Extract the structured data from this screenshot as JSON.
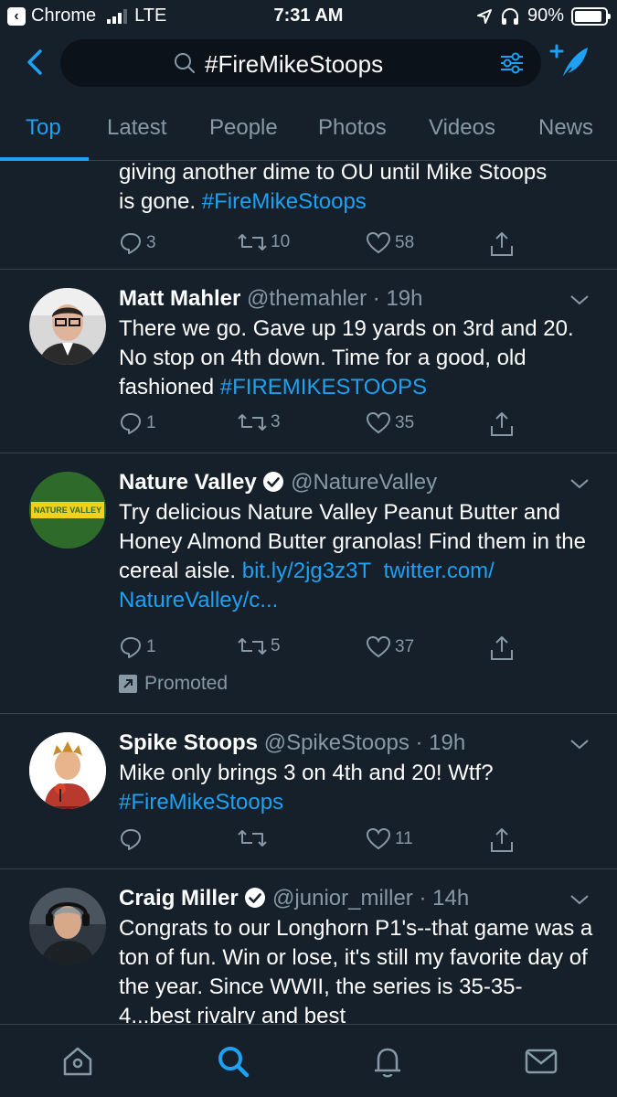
{
  "status_bar": {
    "back_app": "Chrome",
    "network": "LTE",
    "time": "7:31 AM",
    "battery": "90%"
  },
  "search": {
    "query": "#FireMikeStoops"
  },
  "tabs": [
    {
      "label": "Top",
      "active": true
    },
    {
      "label": "Latest",
      "active": false
    },
    {
      "label": "People",
      "active": false
    },
    {
      "label": "Photos",
      "active": false
    },
    {
      "label": "Videos",
      "active": false
    },
    {
      "label": "News",
      "active": false
    }
  ],
  "tweets": [
    {
      "text_line1": "giving another dime to OU until Mike Stoops",
      "text_line2": "is gone. ",
      "hashtag": "#FireMikeStoops",
      "replies": "3",
      "retweets": "10",
      "likes": "58"
    },
    {
      "name": "Matt Mahler",
      "handle": "@themahler",
      "time": "19h",
      "text": "There we go. Gave up 19 yards on 3rd and 20. No stop on 4th down. Time for a good, old fashioned ",
      "hashtag": "#FIREMIKESTOOPS",
      "replies": "1",
      "retweets": "3",
      "likes": "35"
    },
    {
      "name": "Nature Valley",
      "handle": "@NatureValley",
      "verified": true,
      "avatar_text": "NATURE VALLEY",
      "text": "Try delicious Nature Valley Peanut Butter and Honey Almond Butter granolas! Find them in the cereal aisle. ",
      "link1": "bit.ly/2jg3z3T",
      "link2": "twitter.com/",
      "link3": "NatureValley/c...",
      "replies": "1",
      "retweets": "5",
      "likes": "37",
      "promoted": "Promoted"
    },
    {
      "name": "Spike Stoops",
      "handle": "@SpikeStoops",
      "time": "19h",
      "text": "Mike only brings 3 on 4th and 20!  Wtf?",
      "hashtag": "#FireMikeStoops",
      "likes": "11"
    },
    {
      "name": "Craig Miller",
      "handle": "@junior_miller",
      "verified": true,
      "time": "14h",
      "text": "Congrats to our Longhorn P1's--that game was a ton of fun. Win or lose, it's still my favorite day of the year.  Since WWII, the series is 35-35-4...best rivalry and best"
    }
  ],
  "colors": {
    "background": "#15202b",
    "accent": "#1da1f2",
    "secondary_text": "#8899a6",
    "divider": "#38444d"
  }
}
